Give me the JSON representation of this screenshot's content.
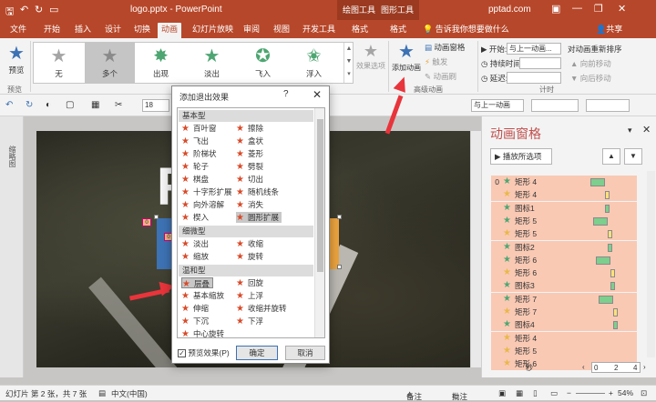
{
  "titlebar": {
    "doc_title": "logo.pptx - PowerPoint",
    "context_tab_drawing": "绘图工具",
    "context_tab_picture": "图形工具",
    "site": "pptad.com",
    "min_glyph": "—",
    "restore_glyph": "❐",
    "close_glyph": "✕"
  },
  "tabs": [
    "文件",
    "开始",
    "插入",
    "设计",
    "切换",
    "动画",
    "幻灯片放映",
    "审阅",
    "视图",
    "开发工具",
    "格式",
    "格式"
  ],
  "active_tab": "动画",
  "tell_me": "告诉我你想要做什么",
  "share": "共享",
  "ribbon": {
    "preview_label": "预览",
    "preview_group": "预览",
    "animations": [
      {
        "label": "无",
        "color": "#a5a5a5"
      },
      {
        "label": "多个",
        "color": "#8a8a8a"
      },
      {
        "label": "出现",
        "color": "#4ea672"
      },
      {
        "label": "淡出",
        "color": "#4ea672"
      },
      {
        "label": "飞入",
        "color": "#4ea672"
      },
      {
        "label": "浮入",
        "color": "#4ea672"
      }
    ],
    "effect_options": "效果选项",
    "add_animation": "添加动画",
    "animation_pane_btn": "动画窗格",
    "trigger": "触发",
    "painter": "动画刷",
    "advanced_group": "高级动画",
    "start_label": "开始:",
    "start_value": "与上一动画...",
    "duration_label": "持续时间:",
    "delay_label": "延迟:",
    "reorder_title": "对动画重新排序",
    "move_earlier": "向前移动",
    "move_later": "向后移动",
    "timing_group": "计时"
  },
  "fmtbar": {
    "font_size": "18",
    "align_value": "与上一动画"
  },
  "thumbs_label": "缩略图",
  "dialog": {
    "title": "添加退出效果",
    "help": "?",
    "close": "✕",
    "categories": [
      {
        "name": "基本型",
        "items": [
          [
            "百叶窗",
            "擦除"
          ],
          [
            "飞出",
            "盒状"
          ],
          [
            "阶梯状",
            "菱形"
          ],
          [
            "轮子",
            "劈裂"
          ],
          [
            "棋盘",
            "切出"
          ],
          [
            "十字形扩展",
            "随机线条"
          ],
          [
            "向外溶解",
            "消失"
          ],
          [
            "楔入",
            "圆形扩展"
          ]
        ]
      },
      {
        "name": "细微型",
        "items": [
          [
            "淡出",
            "收缩"
          ],
          [
            "缩放",
            "旋转"
          ]
        ]
      },
      {
        "name": "温和型",
        "items": [
          [
            "层叠",
            "回旋"
          ],
          [
            "基本缩放",
            "上浮"
          ],
          [
            "伸缩",
            "收缩并旋转"
          ],
          [
            "下沉",
            "下浮"
          ],
          [
            "中心旋转",
            ""
          ]
        ]
      }
    ],
    "highlighted": [
      "圆形扩展",
      "层叠"
    ],
    "preview_checkbox": "预览效果(P)",
    "preview_checked": true,
    "ok": "确定",
    "cancel": "取消"
  },
  "pane": {
    "title": "动画窗格",
    "play_button": "播放所选项",
    "rows": [
      {
        "num": "0",
        "name": "矩形 4",
        "color": "#4ea672",
        "bar": "#7ccf8c",
        "bar_left": 0.68,
        "bar_w": 0.1
      },
      {
        "num": "",
        "name": "矩形 4",
        "color": "#e8b84a",
        "bar": "#ffe07a",
        "bar_left": 0.78,
        "bar_w": 0.03
      },
      {
        "num": "",
        "name": "图标1",
        "color": "#4ea672",
        "bar": "#7ccf8c",
        "bar_left": 0.78,
        "bar_w": 0.03
      },
      {
        "num": "",
        "name": "矩形 5",
        "color": "#4ea672",
        "bar": "#7ccf8c",
        "bar_left": 0.7,
        "bar_w": 0.1
      },
      {
        "num": "",
        "name": "矩形 5",
        "color": "#e8b84a",
        "bar": "#ffe07a",
        "bar_left": 0.8,
        "bar_w": 0.03
      },
      {
        "num": "",
        "name": "图标2",
        "color": "#4ea672",
        "bar": "#7ccf8c",
        "bar_left": 0.8,
        "bar_w": 0.03
      },
      {
        "num": "",
        "name": "矩形 6",
        "color": "#4ea672",
        "bar": "#7ccf8c",
        "bar_left": 0.72,
        "bar_w": 0.1
      },
      {
        "num": "",
        "name": "矩形 6",
        "color": "#e8b84a",
        "bar": "#ffe07a",
        "bar_left": 0.82,
        "bar_w": 0.03
      },
      {
        "num": "",
        "name": "图标3",
        "color": "#4ea672",
        "bar": "#7ccf8c",
        "bar_left": 0.82,
        "bar_w": 0.03
      },
      {
        "num": "",
        "name": "矩形 7",
        "color": "#4ea672",
        "bar": "#7ccf8c",
        "bar_left": 0.74,
        "bar_w": 0.1
      },
      {
        "num": "",
        "name": "矩形 7",
        "color": "#e8b84a",
        "bar": "#ffe07a",
        "bar_left": 0.84,
        "bar_w": 0.03
      },
      {
        "num": "",
        "name": "图标4",
        "color": "#4ea672",
        "bar": "#7ccf8c",
        "bar_left": 0.84,
        "bar_w": 0.03
      },
      {
        "num": "",
        "name": "矩形 4",
        "color": "#e8b84a",
        "bar": "",
        "bar_left": 0,
        "bar_w": 0
      },
      {
        "num": "",
        "name": "矩形 5",
        "color": "#e8b84a",
        "bar": "",
        "bar_left": 0,
        "bar_w": 0
      },
      {
        "num": "",
        "name": "矩形 6",
        "color": "#e8b84a",
        "bar": "",
        "bar_left": 0,
        "bar_w": 0
      }
    ],
    "timeline_label": "秒",
    "timeline_ticks": [
      "0",
      "2",
      "4"
    ]
  },
  "status": {
    "slide_info": "幻灯片 第 2 张，共 7 张",
    "language": "中文(中国)",
    "notes": "备注",
    "comments": "批注",
    "zoom": "54%"
  }
}
